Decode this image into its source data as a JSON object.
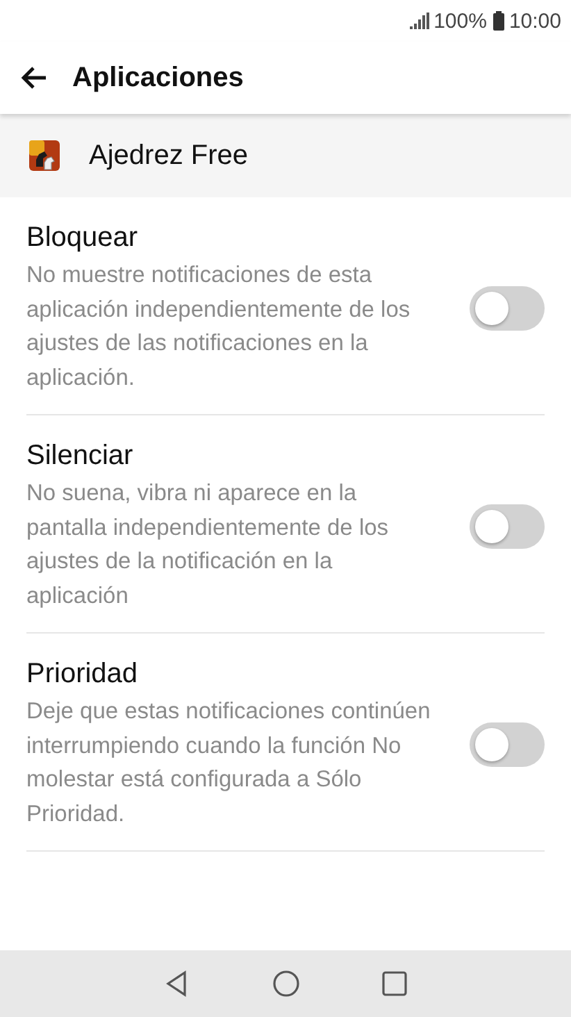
{
  "status_bar": {
    "battery": "100%",
    "time": "10:00"
  },
  "toolbar": {
    "title": "Aplicaciones"
  },
  "app": {
    "name": "Ajedrez Free"
  },
  "settings": [
    {
      "title": "Bloquear",
      "description": "No muestre notificaciones de esta aplicación independientemente de los ajustes de las notificaciones en la aplicación.",
      "on": false
    },
    {
      "title": "Silenciar",
      "description": "No suena, vibra ni aparece en la pantalla independientemente de los ajustes de la notificación en la aplicación",
      "on": false
    },
    {
      "title": "Prioridad",
      "description": "Deje que estas notificaciones continúen interrumpiendo cuando la función No molestar está configurada a Sólo Prioridad.",
      "on": false
    }
  ]
}
